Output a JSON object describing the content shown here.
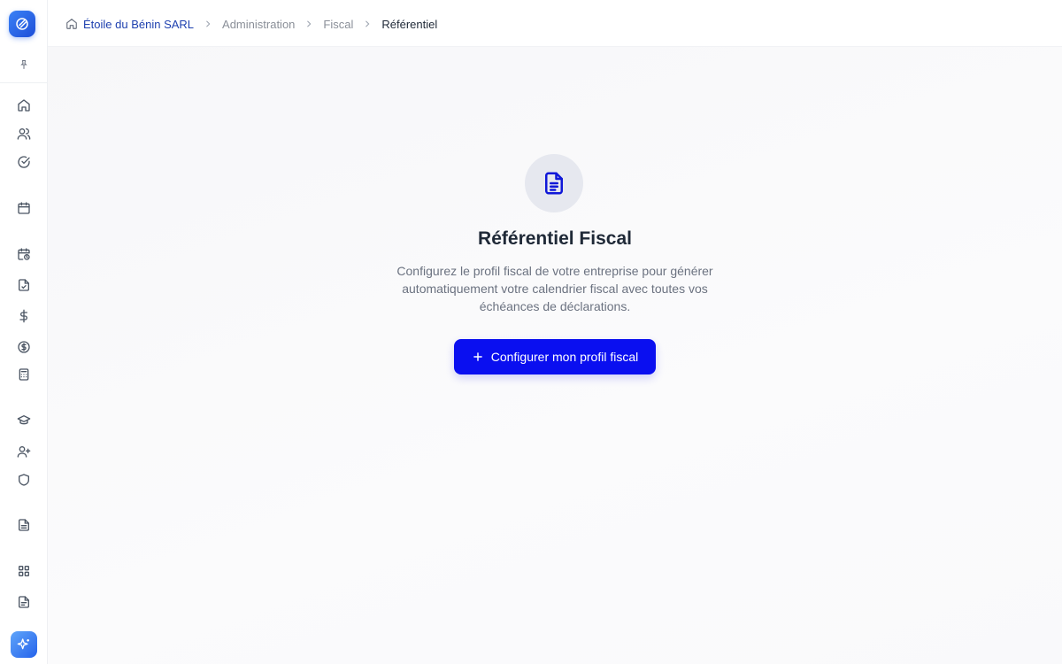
{
  "breadcrumb": {
    "company": "Étoile du Bénin SARL",
    "level1": "Administration",
    "level2": "Fiscal",
    "current": "Référentiel"
  },
  "empty_state": {
    "title": "Référentiel Fiscal",
    "description": "Configurez le profil fiscal de votre entreprise pour générer automatiquement votre calendrier fiscal avec toutes vos échéances de déclarations.",
    "button_label": "Configurer mon profil fiscal",
    "icon": "document-text-icon"
  },
  "sidebar": {
    "items": [
      {
        "icon": "home-icon"
      },
      {
        "icon": "users-icon"
      },
      {
        "icon": "check-circle-icon"
      },
      {
        "icon": "calendar-icon"
      },
      {
        "icon": "calendar-clock-icon"
      },
      {
        "icon": "file-check-icon"
      },
      {
        "icon": "dollar-icon"
      },
      {
        "icon": "dollar-circle-icon"
      },
      {
        "icon": "calculator-icon"
      },
      {
        "icon": "graduation-cap-icon"
      },
      {
        "icon": "user-plus-icon"
      },
      {
        "icon": "shield-icon"
      },
      {
        "icon": "file-text-icon"
      },
      {
        "icon": "grid-icon"
      },
      {
        "icon": "file-list-icon"
      }
    ]
  },
  "colors": {
    "primary": "#0a0ff0",
    "breadcrumb_active": "#1e40af",
    "muted_text": "#6b7280",
    "icon_bg": "#e6e8ef"
  }
}
